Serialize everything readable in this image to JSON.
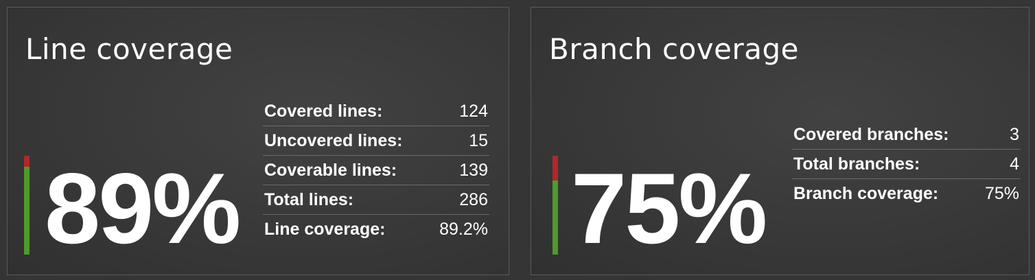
{
  "line_coverage": {
    "title": "Line coverage",
    "percent_text": "89%",
    "bar_covered_fraction": 0.892,
    "stats": [
      {
        "label": "Covered lines:",
        "value": "124"
      },
      {
        "label": "Uncovered lines:",
        "value": "15"
      },
      {
        "label": "Coverable lines:",
        "value": "139"
      },
      {
        "label": "Total lines:",
        "value": "286"
      },
      {
        "label": "Line coverage:",
        "value": "89.2%"
      }
    ]
  },
  "branch_coverage": {
    "title": "Branch coverage",
    "percent_text": "75%",
    "bar_covered_fraction": 0.75,
    "stats": [
      {
        "label": "Covered branches:",
        "value": "3"
      },
      {
        "label": "Total branches:",
        "value": "4"
      },
      {
        "label": "Branch coverage:",
        "value": "75%"
      }
    ]
  },
  "colors": {
    "covered": "#4f9a2a",
    "uncovered": "#b0282a",
    "background": "#353535"
  }
}
